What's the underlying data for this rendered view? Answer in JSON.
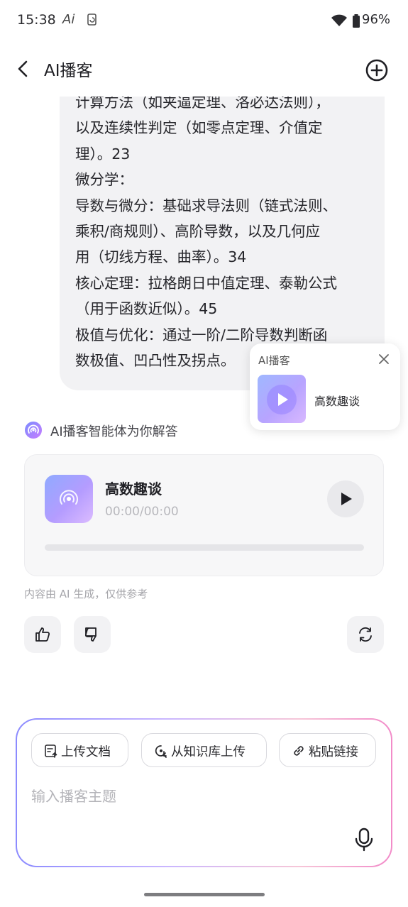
{
  "status_bar": {
    "time": "15:38",
    "ai_indicator": "Ai",
    "battery": "96%"
  },
  "header": {
    "title": "AI播客",
    "back_icon": "chevron-left-icon",
    "add_icon": "plus-circle-icon"
  },
  "message": {
    "lines": [
      "计算方法（如夹逼定理、洛必达法则），",
      "以及连续性判定（如零点定理、介值定",
      "理）。23",
      "微分学：",
      "导数与微分：基础求导法则（链式法则、",
      "乘积/商规则）、高阶导数，以及几何应",
      "用（切线方程、曲率）。34",
      "核心定理：拉格朗日中值定理、泰勒公式",
      "（用于函数近似）。45",
      "极值与优化：通过一阶/二阶导数判断函",
      "数极值、凹凸性及拐点。"
    ]
  },
  "floating_player": {
    "label": "AI播客",
    "track": "高数趣谈"
  },
  "agent": {
    "text": "AI播客智能体为你解答"
  },
  "podcast_card": {
    "title": "高数趣谈",
    "time": "00:00/00:00",
    "progress": 0
  },
  "disclaimer": "内容由 AI 生成，仅供参考",
  "feedback": {
    "like_icon": "thumbs-up-icon",
    "dislike_icon": "thumbs-down-icon",
    "regenerate_icon": "refresh-icon"
  },
  "input": {
    "chips": {
      "upload_doc": "上传文档",
      "from_kb": "从知识库上传",
      "paste_link": "粘贴链接"
    },
    "placeholder": "输入播客主题"
  },
  "colors": {
    "accent": "#8c8bff",
    "gradient_end": "#f28bc9",
    "bubble": "#f2f2f4"
  }
}
